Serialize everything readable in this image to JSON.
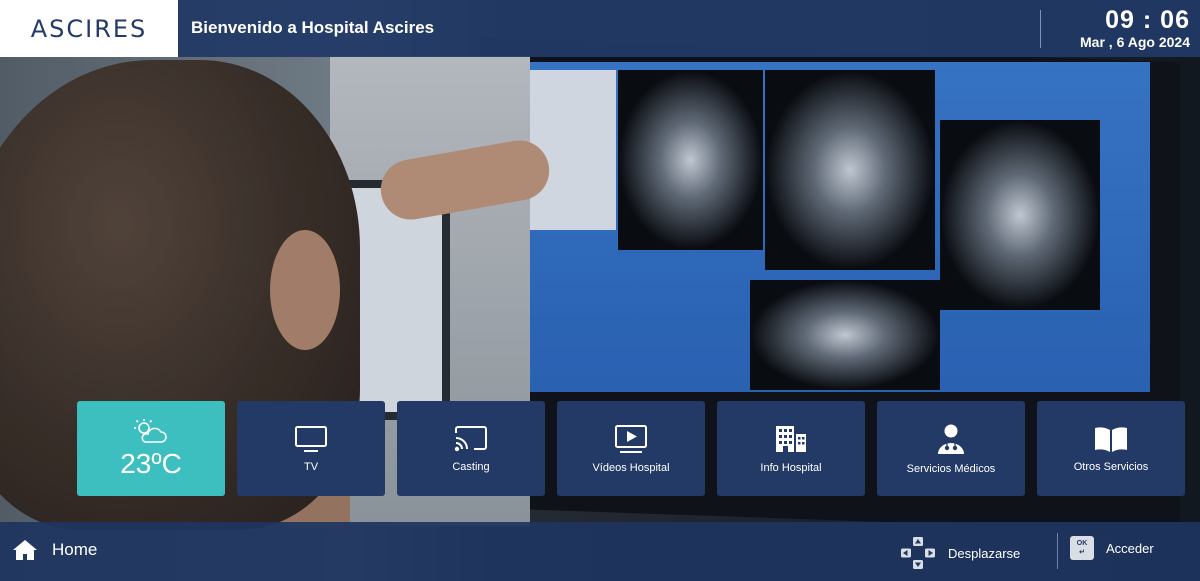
{
  "header": {
    "logo": "ASCIRES",
    "welcome": "Bienvenido a Hospital Ascires",
    "time": "09 : 06",
    "date": "Mar , 6 Ago 2024"
  },
  "tiles": [
    {
      "id": "weather",
      "label": "23ºC",
      "icon": "partly-cloudy-icon"
    },
    {
      "id": "tv",
      "label": "TV",
      "icon": "tv-icon"
    },
    {
      "id": "casting",
      "label": "Casting",
      "icon": "cast-icon"
    },
    {
      "id": "videos",
      "label": "Vídeos Hospital",
      "icon": "play-video-icon"
    },
    {
      "id": "info",
      "label": "Info Hospital",
      "icon": "building-icon"
    },
    {
      "id": "servicios",
      "label": "Servicios Médicos",
      "icon": "doctor-icon"
    },
    {
      "id": "otros",
      "label": "Otros Servicios",
      "icon": "book-icon"
    }
  ],
  "footer": {
    "home": "Home",
    "nav_hint": "Desplazarse",
    "ok_key": "OK",
    "ok_hint": "Acceder"
  },
  "colors": {
    "header_bg": "#213966",
    "tile_bg": "#223a65",
    "weather_bg": "#3dbfbf"
  }
}
